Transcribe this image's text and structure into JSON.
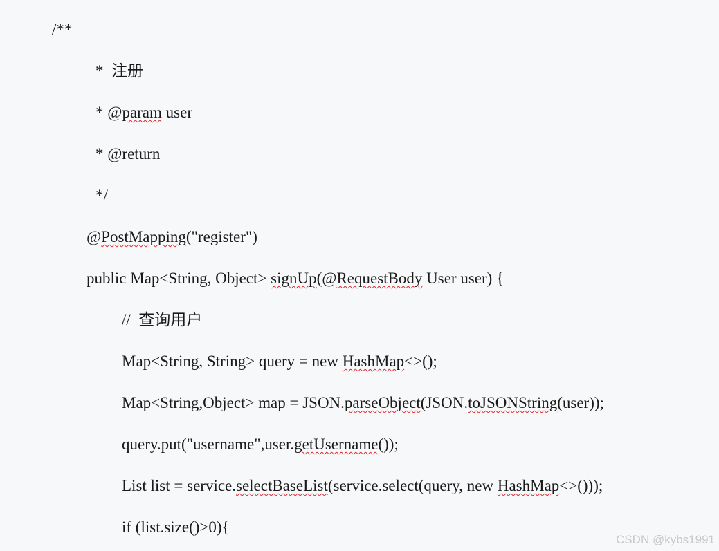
{
  "document": {
    "lines": [
      [
        {
          "text": "/**"
        }
      ],
      [
        {
          "text": "*  注册"
        }
      ],
      [
        {
          "text": "* @"
        },
        {
          "text": "param",
          "flag": true
        },
        {
          "text": " user"
        }
      ],
      [
        {
          "text": "* @return"
        }
      ],
      [
        {
          "text": "*/"
        }
      ],
      [
        {
          "text": "@"
        },
        {
          "text": "PostMapping",
          "flag": true
        },
        {
          "text": "(\"register\")"
        }
      ],
      [
        {
          "text": "public Map<String, Object> "
        },
        {
          "text": "signUp",
          "flag": true
        },
        {
          "text": "(@"
        },
        {
          "text": "RequestBody",
          "flag": true
        },
        {
          "text": " User user) {"
        }
      ],
      [
        {
          "text": "//  查询用户"
        }
      ],
      [
        {
          "text": "Map<String, String> query = new "
        },
        {
          "text": "HashMap",
          "flag": true
        },
        {
          "text": "<>();"
        }
      ],
      [
        {
          "text": "Map<String,Object> map = JSON."
        },
        {
          "text": "parseObject",
          "flag": true
        },
        {
          "text": "(JSON."
        },
        {
          "text": "toJSONString",
          "flag": true
        },
        {
          "text": "(user));"
        }
      ],
      [
        {
          "text": "query.put(\"username\",user."
        },
        {
          "text": "getUsername",
          "flag": true
        },
        {
          "text": "());"
        }
      ],
      [
        {
          "text": "List list = service."
        },
        {
          "text": "selectBaseList",
          "flag": true
        },
        {
          "text": "(service.select(query, new "
        },
        {
          "text": "HashMap",
          "flag": true
        },
        {
          "text": "<>()));"
        }
      ],
      [
        {
          "text": "if (list.size()>0){"
        }
      ]
    ]
  },
  "watermark": {
    "text": "CSDN @kybs1991"
  }
}
